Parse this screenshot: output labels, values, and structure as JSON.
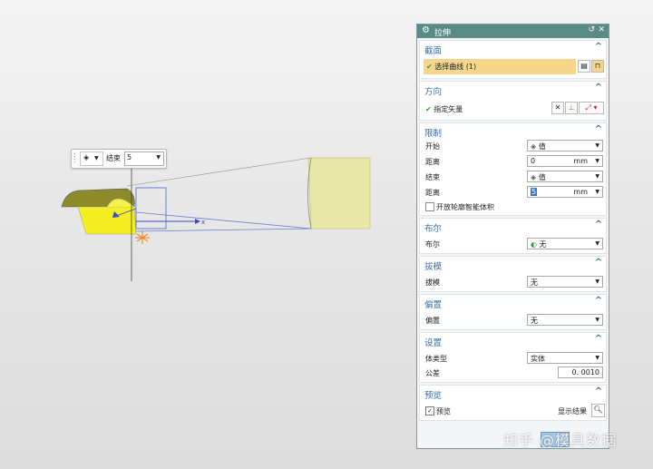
{
  "mini_toolbar": {
    "end_label": "结束",
    "end_value": "5"
  },
  "axis_label": "x",
  "dialog": {
    "title": "拉伸",
    "sections": {
      "section": {
        "title": "截面",
        "select_curve": "选择曲线 (1)"
      },
      "direction": {
        "title": "方向",
        "specify_vector": "指定矢量"
      },
      "limits": {
        "title": "限制",
        "start_label": "开始",
        "start_value": "值",
        "distance1_label": "距离",
        "distance1_value": "0",
        "distance1_unit": "mm",
        "end_label": "结束",
        "end_value": "值",
        "distance2_label": "距离",
        "distance2_value": "5",
        "distance2_unit": "mm",
        "open_profile_label": "开放轮廓智能体积"
      },
      "boolean": {
        "title": "布尔",
        "label": "布尔",
        "value": "无"
      },
      "draft": {
        "title": "拔模",
        "label": "拔模",
        "value": "无"
      },
      "offset": {
        "title": "偏置",
        "label": "偏置",
        "value": "无"
      },
      "settings": {
        "title": "设置",
        "body_type_label": "体类型",
        "body_type_value": "实体",
        "tolerance_label": "公差",
        "tolerance_value": "0. 0010"
      },
      "preview": {
        "title": "预览",
        "preview_label": "预览",
        "show_result_label": "显示结果"
      }
    }
  },
  "watermark": "知乎 @模具数据"
}
